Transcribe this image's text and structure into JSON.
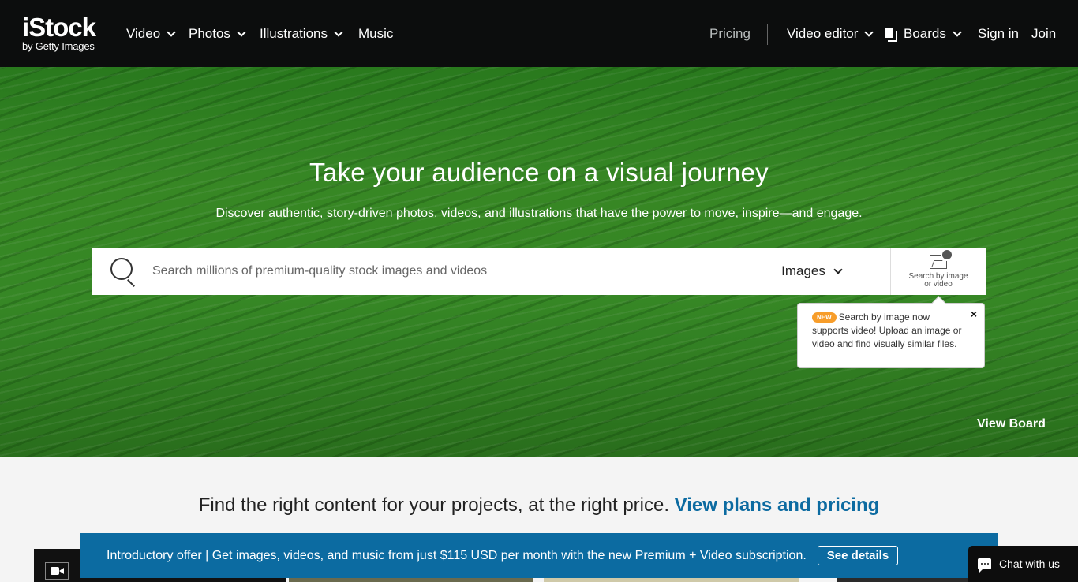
{
  "header": {
    "logo_main": "iStock",
    "logo_sub": "by Getty Images",
    "nav_left": [
      {
        "label": "Video",
        "dropdown": true
      },
      {
        "label": "Photos",
        "dropdown": true
      },
      {
        "label": "Illustrations",
        "dropdown": true
      },
      {
        "label": "Music",
        "dropdown": false
      }
    ],
    "pricing": "Pricing",
    "video_editor": "Video editor",
    "boards": "Boards",
    "sign_in": "Sign in",
    "join": "Join"
  },
  "hero": {
    "title": "Take your audience on a visual journey",
    "subtitle": "Discover authentic, story-driven photos, videos, and illustrations that have the power to move, inspire—and engage.",
    "search_placeholder": "Search millions of premium-quality stock images and videos",
    "search_type": "Images",
    "image_search_label_1": "Search by image",
    "image_search_label_2": "or video",
    "view_board": "View Board"
  },
  "tooltip": {
    "badge": "NEW",
    "text": "Search by image now supports video! Upload an image or video and find visually similar files.",
    "close": "×"
  },
  "content": {
    "tagline": "Find the right content for your projects, at the right price.",
    "tagline_link": "View plans and pricing"
  },
  "promo": {
    "text": "Introductory offer | Get images, videos, and music from just $115 USD per month with the new Premium + Video subscription.",
    "button": "See details"
  },
  "chat": {
    "label": "Chat with us"
  },
  "colors": {
    "topbar": "#0c0d0d",
    "accent_blue": "#0c6ba1",
    "new_badge": "#f79d2a"
  }
}
